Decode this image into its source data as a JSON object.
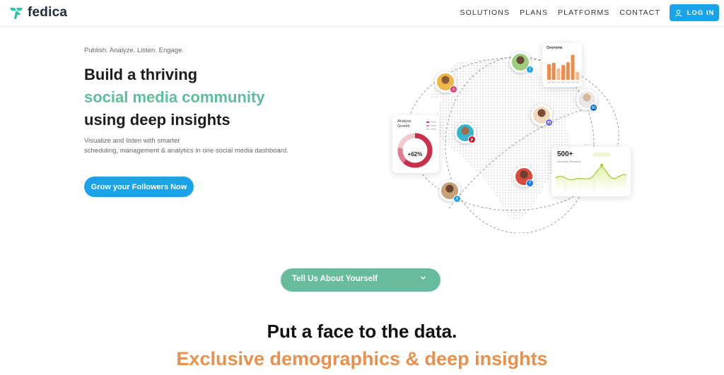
{
  "brand": {
    "name": "fedica",
    "color": "#1e2b3c",
    "accent": "#2ec4a4"
  },
  "nav": {
    "links": [
      "SOLUTIONS",
      "PLANS",
      "PLATFORMS",
      "CONTACT"
    ],
    "login_label": "LOG IN",
    "login_color": "#1aa3e8"
  },
  "hero": {
    "tagline": "Publish. Analyze. Listen. Engage.",
    "headline_line1": "Build a thriving",
    "headline_line2": "social media community",
    "headline_line3": "using deep insights",
    "subtext_line1": "Visualize and listen with smarter",
    "subtext_line2": "scheduling, management & analytics in one social media dashboard.",
    "cta_label": "Grow your Followers Now",
    "accent_color": "#5cbf9a"
  },
  "graphic": {
    "overview_title": "Overview",
    "analyse_title_line1": "Analyse",
    "analyse_title_line2": "Growth",
    "donut_value": "+62%",
    "growth_value": "500+",
    "growth_caption": "Accounts Reached",
    "overview_bars": [
      0.55,
      0.6,
      0.4,
      0.52,
      0.62,
      0.88,
      0.28
    ],
    "social_icons": [
      "twitter-icon",
      "instagram-icon",
      "linkedin-icon",
      "facebook-icon",
      "pinterest-icon",
      "mastodon-icon"
    ]
  },
  "survey": {
    "label": "Tell Us About Yourself",
    "color": "#66bc9c"
  },
  "section": {
    "title": "Put a face to the data.",
    "subtitle": "Exclusive demographics & deep insights",
    "subtitle_color": "#e8914f"
  }
}
